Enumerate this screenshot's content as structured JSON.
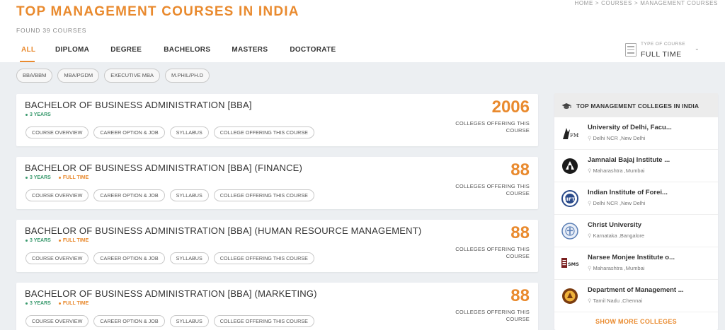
{
  "header": {
    "title": "TOP MANAGEMENT COURSES IN INDIA",
    "found": "FOUND 39 COURSES",
    "breadcrumb": [
      "HOME",
      "COURSES",
      "MANAGEMENT COURSES"
    ],
    "breadcrumb_separator": ">"
  },
  "tabs": [
    "ALL",
    "DIPLOMA",
    "DEGREE",
    "BACHELORS",
    "MASTERS",
    "DOCTORATE"
  ],
  "active_tab": "ALL",
  "type_filter": {
    "label": "TYPE OF COURSE",
    "value": "FULL TIME",
    "icon": "document-list-icon"
  },
  "chips": [
    "BBA/BBM",
    "MBA/PGDM",
    "EXECUTIVE MBA",
    "M.PHIL/PH.D"
  ],
  "courses": [
    {
      "title": "BACHELOR OF BUSINESS ADMINISTRATION [BBA]",
      "duration": "3 YEARS",
      "mode": "",
      "count": "2006",
      "count_label": "COLLEGES OFFERING THIS COURSE",
      "actions": [
        "COURSE OVERVIEW",
        "CAREER OPTION & JOB",
        "SYLLABUS",
        "COLLEGE OFFERING THIS COURSE"
      ]
    },
    {
      "title": "BACHELOR OF BUSINESS ADMINISTRATION [BBA] (FINANCE)",
      "duration": "3 YEARS",
      "mode": "FULL TIME",
      "count": "88",
      "count_label": "COLLEGES OFFERING THIS COURSE",
      "actions": [
        "COURSE OVERVIEW",
        "CAREER OPTION & JOB",
        "SYLLABUS",
        "COLLEGE OFFERING THIS COURSE"
      ]
    },
    {
      "title": "BACHELOR OF BUSINESS ADMINISTRATION [BBA] (HUMAN RESOURCE MANAGEMENT)",
      "duration": "3 YEARS",
      "mode": "FULL TIME",
      "count": "88",
      "count_label": "COLLEGES OFFERING THIS COURSE",
      "actions": [
        "COURSE OVERVIEW",
        "CAREER OPTION & JOB",
        "SYLLABUS",
        "COLLEGE OFFERING THIS COURSE"
      ]
    },
    {
      "title": "BACHELOR OF BUSINESS ADMINISTRATION [BBA] (MARKETING)",
      "duration": "3 YEARS",
      "mode": "FULL TIME",
      "count": "88",
      "count_label": "COLLEGES OFFERING THIS COURSE",
      "actions": [
        "COURSE OVERVIEW",
        "CAREER OPTION & JOB",
        "SYLLABUS",
        "COLLEGE OFFERING THIS COURSE"
      ]
    }
  ],
  "sidebar": {
    "title": "TOP MANAGEMENT COLLEGES IN INDIA",
    "icon": "graduation-cap-icon",
    "colleges": [
      {
        "name": "University of Delhi, Facu...",
        "location": "Delhi NCR ,New Delhi",
        "logo": "university-of-delhi-logo"
      },
      {
        "name": "Jamnalal Bajaj Institute ...",
        "location": "Maharashtra ,Mumbai",
        "logo": "jamnalal-bajaj-logo"
      },
      {
        "name": "Indian Institute of Forei...",
        "location": "Delhi NCR ,New Delhi",
        "logo": "iift-logo"
      },
      {
        "name": "Christ University",
        "location": "Karnataka ,Bangalore",
        "logo": "christ-university-logo"
      },
      {
        "name": "Narsee Monjee Institute o...",
        "location": "Maharashtra ,Mumbai",
        "logo": "nmims-logo"
      },
      {
        "name": "Department of Management ...",
        "location": "Tamil Nadu ,Chennai",
        "logo": "department-of-management-logo"
      }
    ],
    "show_more": "SHOW MORE COLLEGES"
  },
  "colors": {
    "accent": "#e98a2e",
    "duration": "#3a9a6e",
    "background": "#eceff2"
  }
}
